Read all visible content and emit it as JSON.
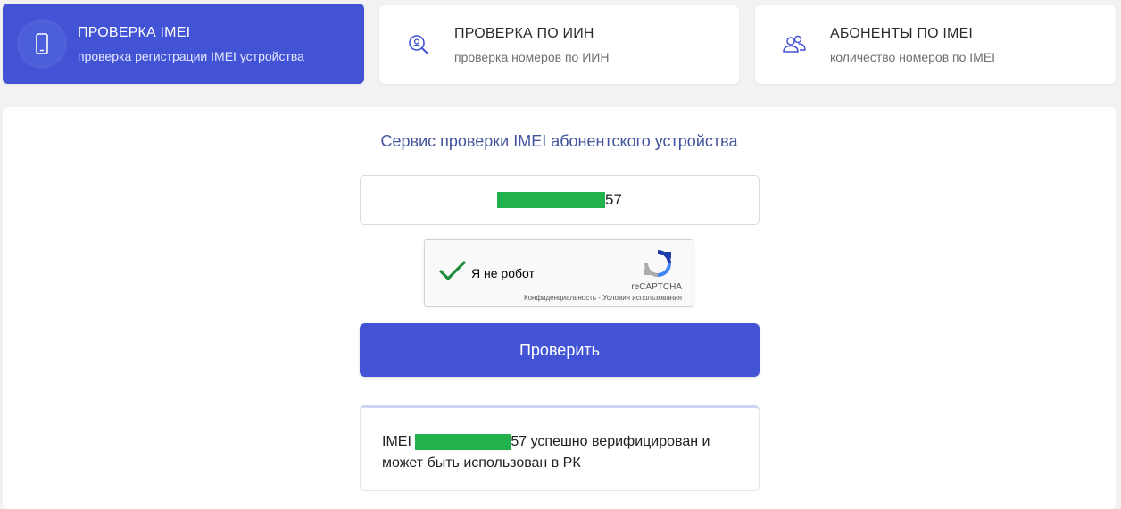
{
  "tabs": [
    {
      "title": "ПРОВЕРКА IMEI",
      "subtitle": "проверка регистрации IMEI устройства",
      "icon": "smartphone-icon",
      "active": true
    },
    {
      "title": "ПРОВЕРКА ПО ИИН",
      "subtitle": "проверка номеров по ИИН",
      "icon": "user-search-icon",
      "active": false
    },
    {
      "title": "АБОНЕНТЫ ПО IMEI",
      "subtitle": "количество номеров по IMEI",
      "icon": "users-icon",
      "active": false
    }
  ],
  "service": {
    "title": "Сервис проверки IMEI абонентского устройства",
    "imei_suffix": "57"
  },
  "captcha": {
    "label": "Я не робот",
    "brand": "reCAPTCHA",
    "links": "Конфиденциальность - Условия использования",
    "checked": true
  },
  "submit": {
    "label": "Проверить"
  },
  "result": {
    "prefix": "IMEI ",
    "suffix": "57 успешно верифицирован и может быть использован в РК"
  },
  "colors": {
    "accent": "#4253d6",
    "mask": "#22b14c",
    "title": "#43549e",
    "check": "#1e8e3e"
  }
}
